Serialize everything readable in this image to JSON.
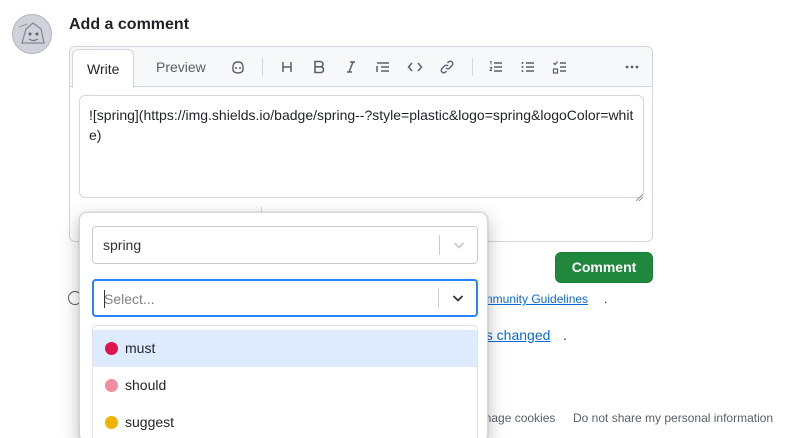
{
  "heading": "Add a comment",
  "editor": {
    "tabs": {
      "write": "Write",
      "preview": "Preview"
    },
    "content": "![spring](https://img.shields.io/badge/spring--?style=plastic&logo=spring&logoColor=white)",
    "toolbar_icons": [
      "copilot-icon",
      "heading-icon",
      "bold-icon",
      "italic-icon",
      "quote-icon",
      "code-icon",
      "link-icon",
      "ordered-list-icon",
      "unordered-list-icon",
      "task-list-icon",
      "more-icon"
    ]
  },
  "comment_button": "Comment",
  "guidelines_link": "ommunity Guidelines",
  "guidelines_tail": ".",
  "changes_link": "es changed",
  "changes_tail": ".",
  "footer": {
    "manage_cookies": "anage cookies",
    "do_not_share": "Do not share my personal information"
  },
  "popover": {
    "first_select_value": "spring",
    "second_select_placeholder": "Select...",
    "options": [
      {
        "label": "must",
        "color": "#e0144c"
      },
      {
        "label": "should",
        "color": "#f28ca0"
      },
      {
        "label": "suggest",
        "color": "#f0b400"
      }
    ],
    "focused_option": "must"
  },
  "colors": {
    "primary_button": "#1f883d",
    "link": "#0969da",
    "focus_border": "#2684ff",
    "focused_option_bg": "#deebff"
  }
}
